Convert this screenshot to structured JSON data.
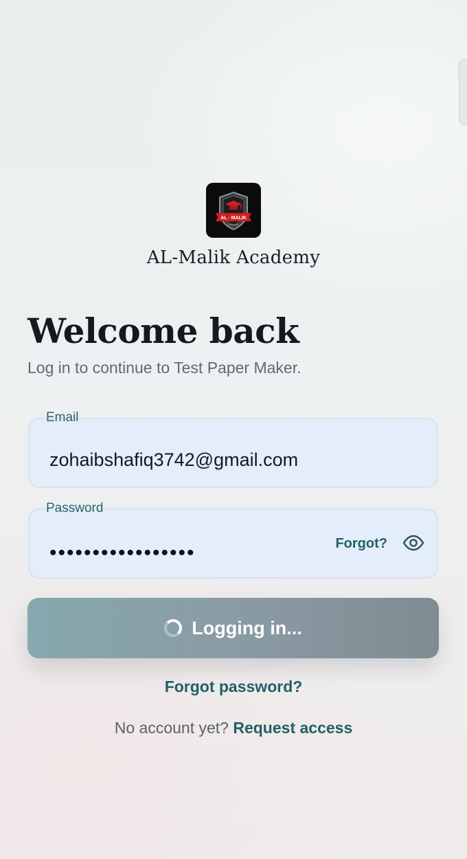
{
  "brand": {
    "name": "AL-Malik Academy",
    "logo_text": "AL - MALIK",
    "logo_icon": "shield-graduation-cap-icon"
  },
  "header": {
    "title": "Welcome back",
    "subtitle": "Log in to continue to Test Paper Maker."
  },
  "form": {
    "email": {
      "label": "Email",
      "value": "zohaibshafiq3742@gmail.com"
    },
    "password": {
      "label": "Password",
      "masked_value": "•••••••••••••••••",
      "forgot_label": "Forgot?",
      "toggle_icon": "eye-icon"
    },
    "submit": {
      "label": "Logging in...",
      "state_icon": "spinner-icon"
    }
  },
  "links": {
    "forgot_password": "Forgot password?",
    "no_account_text": "No account yet?",
    "request_access": "Request access"
  },
  "colors": {
    "accent": "#235f66",
    "field_background": "#e4eefb",
    "button_gradient_start": "#86a8ae",
    "button_gradient_end": "#7f8b92",
    "logo_red": "#d11f1f"
  }
}
